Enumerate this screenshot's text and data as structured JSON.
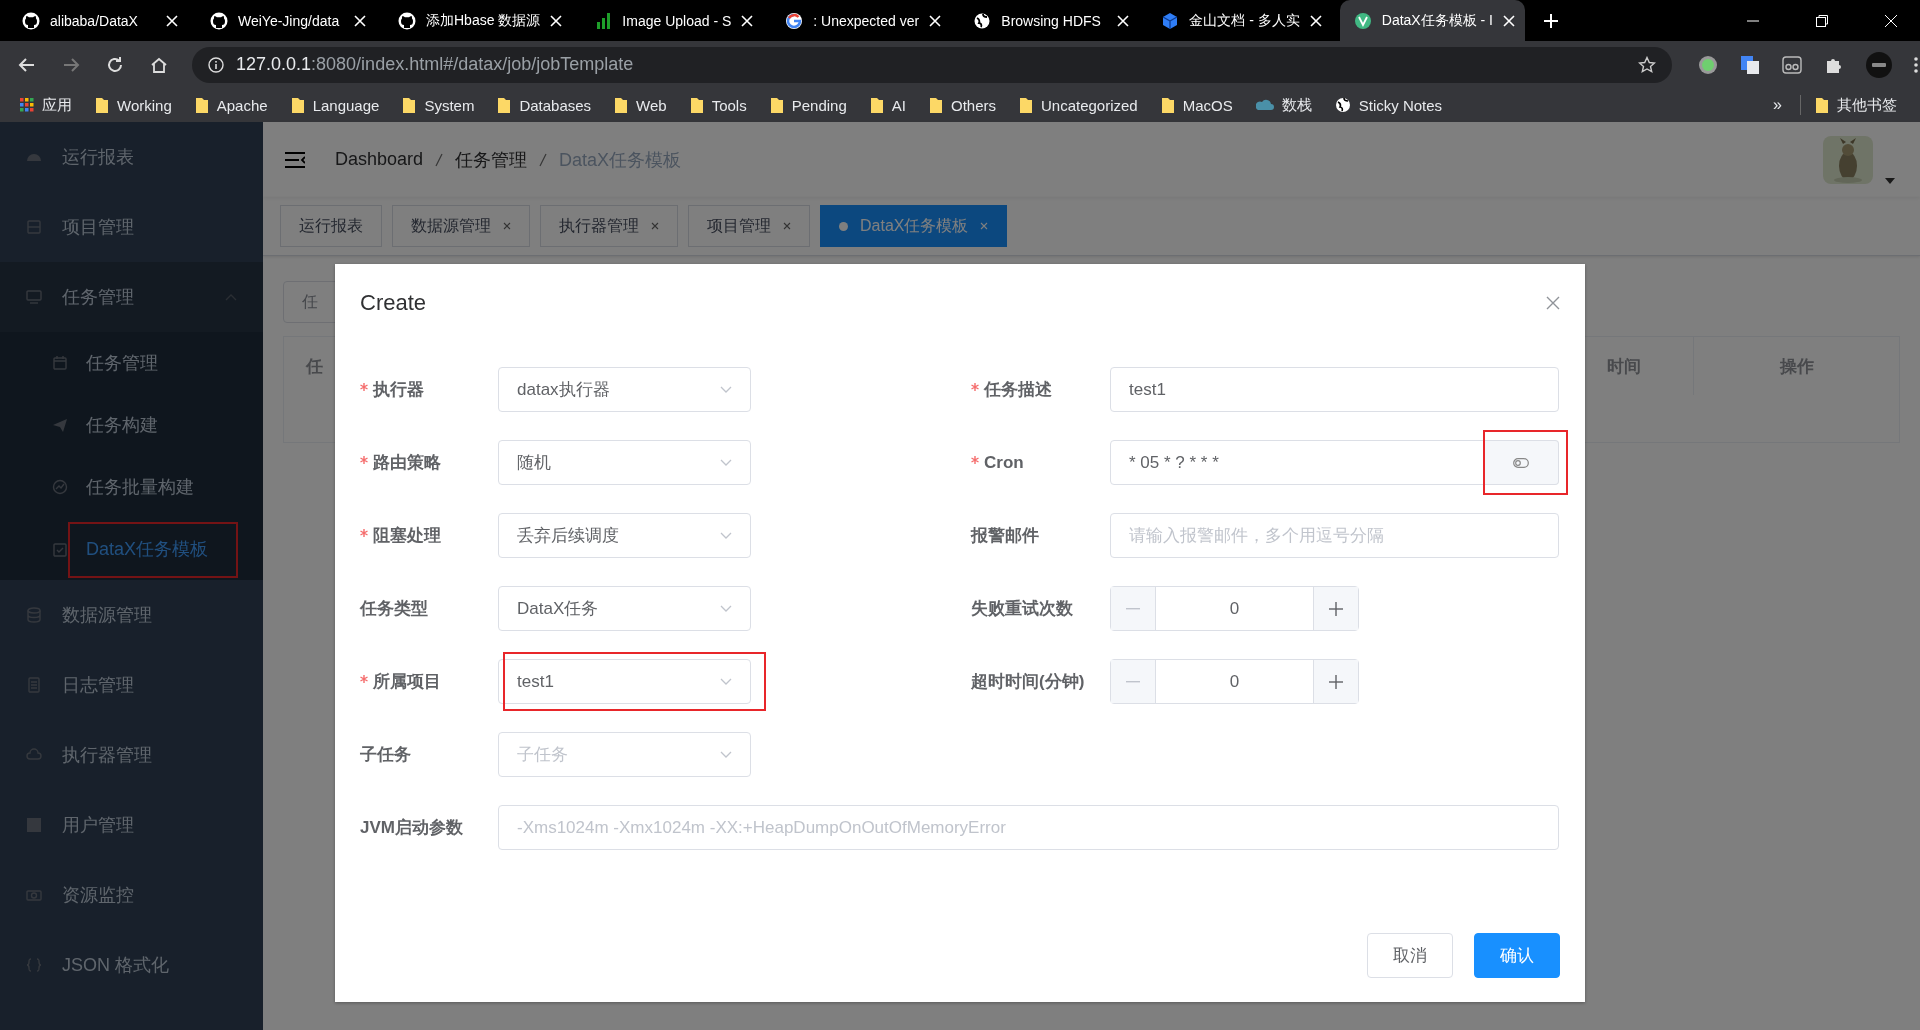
{
  "browser": {
    "tabs": [
      {
        "title": "alibaba/DataX",
        "selected": false
      },
      {
        "title": "WeiYe-Jing/data",
        "selected": false
      },
      {
        "title": "添加Hbase 数据源",
        "selected": false
      },
      {
        "title": "Image Upload - S",
        "selected": false
      },
      {
        "title": ": Unexpected ver",
        "selected": false
      },
      {
        "title": "Browsing HDFS",
        "selected": false
      },
      {
        "title": "金山文档 - 多人实",
        "selected": false
      },
      {
        "title": "DataX任务模板 - I",
        "selected": true
      }
    ],
    "address": {
      "host": "127.0.0.1",
      "rest": ":8080/index.html#/datax/job/jobTemplate"
    },
    "bookmarks": [
      {
        "label": "应用",
        "kind": "apps"
      },
      {
        "label": "Working",
        "kind": "folder"
      },
      {
        "label": "Apache",
        "kind": "folder"
      },
      {
        "label": "Language",
        "kind": "folder"
      },
      {
        "label": "System",
        "kind": "folder"
      },
      {
        "label": "Databases",
        "kind": "folder"
      },
      {
        "label": "Web",
        "kind": "folder"
      },
      {
        "label": "Tools",
        "kind": "folder"
      },
      {
        "label": "Pending",
        "kind": "folder"
      },
      {
        "label": "AI",
        "kind": "folder"
      },
      {
        "label": "Others",
        "kind": "folder"
      },
      {
        "label": "Uncategorized",
        "kind": "folder"
      },
      {
        "label": "MacOS",
        "kind": "folder"
      },
      {
        "label": "数栈",
        "kind": "cloud"
      },
      {
        "label": "Sticky Notes",
        "kind": "globe"
      }
    ],
    "bookmarks_overflow": "»",
    "other_bookmarks": "其他书签"
  },
  "sidebar": {
    "items": [
      {
        "label": "运行报表",
        "selected": false
      },
      {
        "label": "项目管理",
        "selected": false
      },
      {
        "label": "任务管理",
        "selected": false,
        "expanded": true,
        "children": [
          {
            "label": "任务管理",
            "selected": false
          },
          {
            "label": "任务构建",
            "selected": false
          },
          {
            "label": "任务批量构建",
            "selected": false
          },
          {
            "label": "DataX任务模板",
            "selected": true,
            "highlighted": true
          }
        ]
      },
      {
        "label": "数据源管理",
        "selected": false
      },
      {
        "label": "日志管理",
        "selected": false
      },
      {
        "label": "执行器管理",
        "selected": false
      },
      {
        "label": "用户管理",
        "selected": false
      },
      {
        "label": "资源监控",
        "selected": false
      },
      {
        "label": "JSON 格式化",
        "selected": false
      }
    ]
  },
  "breadcrumb": [
    "Dashboard",
    "任务管理",
    "DataX任务模板"
  ],
  "view_tags": [
    {
      "label": "运行报表",
      "closable": false,
      "selected": false
    },
    {
      "label": "数据源管理",
      "closable": true,
      "selected": false
    },
    {
      "label": "执行器管理",
      "closable": true,
      "selected": false
    },
    {
      "label": "项目管理",
      "closable": true,
      "selected": false
    },
    {
      "label": "DataX任务模板",
      "closable": true,
      "selected": true
    }
  ],
  "background": {
    "search_placeholder": "任",
    "table_columns": [
      "任",
      "时间",
      "操作"
    ]
  },
  "dialog": {
    "title": "Create",
    "left_fields": [
      {
        "label": "执行器",
        "required": true,
        "kind": "select",
        "value": "datax执行器"
      },
      {
        "label": "路由策略",
        "required": true,
        "kind": "select",
        "value": "随机"
      },
      {
        "label": "阻塞处理",
        "required": true,
        "kind": "select",
        "value": "丢弃后续调度"
      },
      {
        "label": "任务类型",
        "required": false,
        "kind": "select",
        "value": "DataX任务"
      },
      {
        "label": "所属项目",
        "required": true,
        "kind": "select",
        "value": "test1",
        "highlighted": true
      },
      {
        "label": "子任务",
        "required": false,
        "kind": "select",
        "placeholder": "子任务"
      }
    ],
    "right_fields": [
      {
        "label": "任务描述",
        "required": true,
        "kind": "input",
        "value": "test1"
      },
      {
        "label": "Cron",
        "required": true,
        "kind": "cron",
        "value": "* 05 * ? * * *",
        "highlighted": true
      },
      {
        "label": "报警邮件",
        "required": false,
        "kind": "input",
        "placeholder": "请输入报警邮件，多个用逗号分隔"
      },
      {
        "label": "失败重试次数",
        "required": false,
        "kind": "number",
        "value": "0"
      },
      {
        "label": "超时时间(分钟)",
        "required": false,
        "kind": "number",
        "value": "0"
      }
    ],
    "jvm": {
      "label": "JVM启动参数",
      "placeholder": "-Xms1024m -Xmx1024m -XX:+HeapDumpOnOutOfMemoryError"
    },
    "buttons": [
      {
        "label": "取消",
        "kind": "default"
      },
      {
        "label": "确认",
        "kind": "primary"
      }
    ]
  }
}
